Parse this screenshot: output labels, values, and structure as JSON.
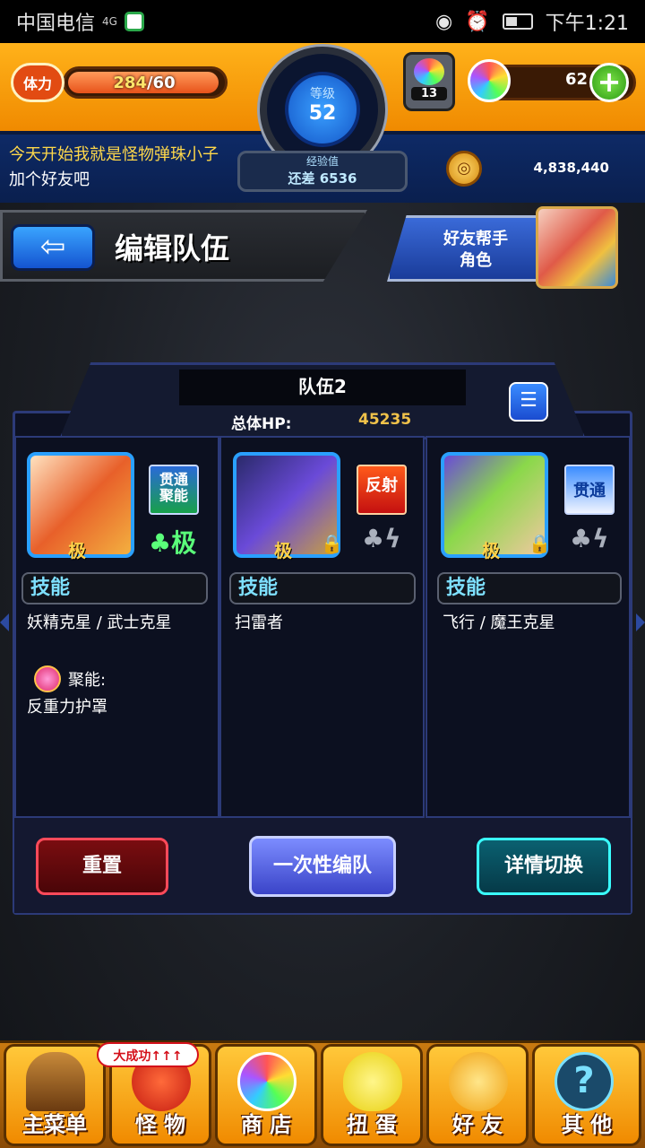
{
  "status": {
    "carrier": "中国电信",
    "signal": "4G",
    "time": "下午1:21"
  },
  "hud": {
    "stamina_label": "体力",
    "stamina_current": "284",
    "stamina_max": "/60",
    "level_label": "等级",
    "level": "52",
    "exp_label": "经验值",
    "exp_remaining": "还差 6536",
    "egg_count": "13",
    "orb_count": "62",
    "coin_count": "4,838,440",
    "plus": "+"
  },
  "messages": {
    "line1": "今天开始我就是怪物弹珠小子",
    "line2": "加个好友吧"
  },
  "header": {
    "back": "⇦",
    "title": "编辑队伍",
    "friend_helper": [
      "好友帮手",
      "角色"
    ]
  },
  "team": {
    "name": "队伍2",
    "hp_label": "总体HP:",
    "hp_value": "45235",
    "list_icon": "☰"
  },
  "members": [
    {
      "badge": "贯通\n聚能",
      "luck": "♣极",
      "level_tag": "极",
      "skill_label": "技能",
      "abilities": "妖精克星 / 武士克星",
      "extra_label": "聚能:",
      "extra_value": "反重力护罩"
    },
    {
      "badge": "反射",
      "luck": "♣ϟ",
      "level_tag": "极",
      "skill_label": "技能",
      "abilities": "扫雷者"
    },
    {
      "badge": "贯通",
      "luck": "♣ϟ",
      "level_tag": "极",
      "skill_label": "技能",
      "abilities": "飞行 / 魔王克星"
    }
  ],
  "actions": {
    "reset": "重置",
    "one_time": "一次性编队",
    "detail_switch": "详情切换"
  },
  "nav": {
    "items": [
      "主菜单",
      "怪 物",
      "商 店",
      "扭 蛋",
      "好 友",
      "其 他"
    ],
    "promo": "大成功↑↑↑"
  }
}
